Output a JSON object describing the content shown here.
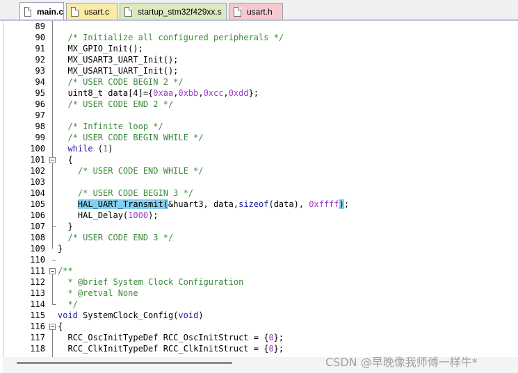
{
  "tabs": [
    {
      "label": "main.c",
      "color": "#ffffff",
      "active": true
    },
    {
      "label": "usart.c",
      "color": "#fbe9a6",
      "active": false
    },
    {
      "label": "startup_stm32f429xx.s",
      "color": "#dce8c0",
      "active": false
    },
    {
      "label": "usart.h",
      "color": "#f6c9cf",
      "active": false
    }
  ],
  "lines": [
    {
      "n": "89",
      "segs": []
    },
    {
      "n": "90",
      "segs": [
        {
          "t": "  "
        },
        {
          "t": "/* Initialize all configured peripherals */",
          "c": "cm"
        }
      ]
    },
    {
      "n": "91",
      "segs": [
        {
          "t": "  MX_GPIO_Init();"
        }
      ]
    },
    {
      "n": "92",
      "segs": [
        {
          "t": "  MX_USART3_UART_Init();"
        }
      ]
    },
    {
      "n": "93",
      "segs": [
        {
          "t": "  MX_USART1_UART_Init();"
        }
      ]
    },
    {
      "n": "94",
      "segs": [
        {
          "t": "  "
        },
        {
          "t": "/* USER CODE BEGIN 2 */",
          "c": "cm"
        }
      ]
    },
    {
      "n": "95",
      "segs": [
        {
          "t": "  uint8_t data[4]={"
        },
        {
          "t": "0xaa",
          "c": "num"
        },
        {
          "t": ","
        },
        {
          "t": "0xbb",
          "c": "num"
        },
        {
          "t": ","
        },
        {
          "t": "0xcc",
          "c": "num"
        },
        {
          "t": ","
        },
        {
          "t": "0xdd",
          "c": "num"
        },
        {
          "t": "};"
        }
      ]
    },
    {
      "n": "96",
      "segs": [
        {
          "t": "  "
        },
        {
          "t": "/* USER CODE END 2 */",
          "c": "cm"
        }
      ]
    },
    {
      "n": "97",
      "segs": []
    },
    {
      "n": "98",
      "segs": [
        {
          "t": "  "
        },
        {
          "t": "/* Infinite loop */",
          "c": "cm"
        }
      ]
    },
    {
      "n": "99",
      "segs": [
        {
          "t": "  "
        },
        {
          "t": "/* USER CODE BEGIN WHILE */",
          "c": "cm"
        }
      ]
    },
    {
      "n": "100",
      "segs": [
        {
          "t": "  "
        },
        {
          "t": "while",
          "c": "kw"
        },
        {
          "t": " ("
        },
        {
          "t": "1",
          "c": "num"
        },
        {
          "t": ")"
        }
      ]
    },
    {
      "n": "101",
      "segs": [
        {
          "t": "  {"
        }
      ]
    },
    {
      "n": "102",
      "segs": [
        {
          "t": "    "
        },
        {
          "t": "/* USER CODE END WHILE */",
          "c": "cm"
        }
      ]
    },
    {
      "n": "103",
      "segs": []
    },
    {
      "n": "104",
      "segs": [
        {
          "t": "    "
        },
        {
          "t": "/* USER CODE BEGIN 3 */",
          "c": "cm"
        }
      ]
    },
    {
      "n": "105",
      "segs": [
        {
          "t": "    "
        },
        {
          "t": "HAL_UART_Transmit",
          "c": "hl"
        },
        {
          "t": "(",
          "c": "br"
        },
        {
          "t": "&huart3, data,"
        },
        {
          "t": "sizeof",
          "c": "kw"
        },
        {
          "t": "(data), "
        },
        {
          "t": "0xffff",
          "c": "num"
        },
        {
          "t": ")",
          "c": "br"
        },
        {
          "t": ";"
        }
      ]
    },
    {
      "n": "106",
      "segs": [
        {
          "t": "    HAL_Delay("
        },
        {
          "t": "1000",
          "c": "num"
        },
        {
          "t": ");"
        }
      ]
    },
    {
      "n": "107",
      "segs": [
        {
          "t": "  }"
        }
      ]
    },
    {
      "n": "108",
      "segs": [
        {
          "t": "  "
        },
        {
          "t": "/* USER CODE END 3 */",
          "c": "cm"
        }
      ]
    },
    {
      "n": "109",
      "segs": [
        {
          "t": "}"
        }
      ]
    },
    {
      "n": "110",
      "segs": []
    },
    {
      "n": "111",
      "segs": [
        {
          "t": "/**",
          "c": "cm"
        }
      ]
    },
    {
      "n": "112",
      "segs": [
        {
          "t": "  * @brief System Clock Configuration",
          "c": "cm"
        }
      ]
    },
    {
      "n": "113",
      "segs": [
        {
          "t": "  * @retval None",
          "c": "cm"
        }
      ]
    },
    {
      "n": "114",
      "segs": [
        {
          "t": "  */",
          "c": "cm"
        }
      ]
    },
    {
      "n": "115",
      "segs": [
        {
          "t": "void",
          "c": "kw"
        },
        {
          "t": " SystemClock_Config("
        },
        {
          "t": "void",
          "c": "kw"
        },
        {
          "t": ")"
        }
      ]
    },
    {
      "n": "116",
      "segs": [
        {
          "t": "{"
        }
      ]
    },
    {
      "n": "117",
      "segs": [
        {
          "t": "  RCC_OscInitTypeDef RCC_OscInitStruct = {"
        },
        {
          "t": "0",
          "c": "num"
        },
        {
          "t": "};"
        }
      ]
    },
    {
      "n": "118",
      "segs": [
        {
          "t": "  RCC_ClkInitTypeDef RCC_ClkInitStruct = {"
        },
        {
          "t": "0",
          "c": "num"
        },
        {
          "t": "};"
        }
      ]
    }
  ],
  "watermark": "CSDN @早晚像我师傅一样牛*"
}
